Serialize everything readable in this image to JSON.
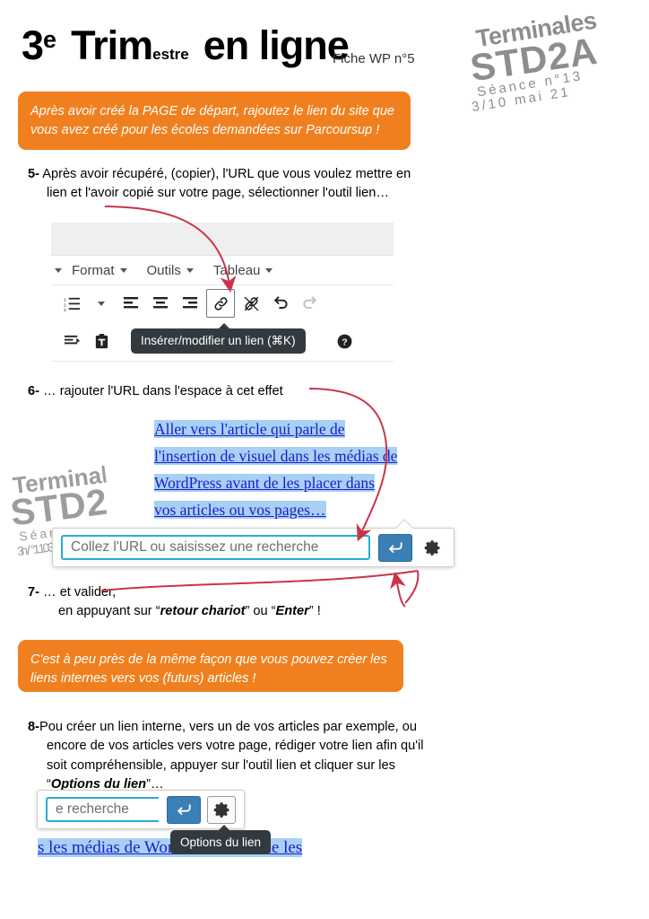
{
  "header": {
    "title_main_1": "3",
    "title_sup": "e",
    "title_main_2": "Trim",
    "title_sub": "estre",
    "title_main_3": "en ligne",
    "sheet_ref": "Fiche WP n°5"
  },
  "logo": {
    "line1": "Terminales",
    "line2": "STD2A",
    "line3": "Séance n°13",
    "line4": "3/10 mai 21"
  },
  "callouts": {
    "first": "Après avoir créé la PAGE de départ, rajoutez le lien du site que vous avez créé pour les écoles demandées sur Parcoursup !",
    "second": "C'est à peu près de la même façon que vous pouvez créer les liens internes vers vos (futurs) articles !"
  },
  "steps": {
    "s5_num": "5-",
    "s5_text": "Après avoir récupéré, (copier), l'URL que vous voulez mettre en lien et l'avoir copié sur votre page, sélectionner l'outil lien…",
    "s6_num": "6-",
    "s6_text": "… rajouter l'URL dans l'espace à cet effet",
    "s7_num": "7-",
    "s7_text": "… et valider,",
    "s7_line2_a": "en appuyant sur “",
    "s7_line2_em1": "retour chariot",
    "s7_line2_b": "” ou “",
    "s7_line2_em2": "Enter",
    "s7_line2_c": "” !",
    "s8_num": "8-",
    "s8_text_a": "Pou créer un lien interne, vers un de vos articles par exemple, ou encore de vos articles vers votre page, rédiger votre lien afin qu'il soit compréhensible, appuyer sur l'outil lien et cliquer sur les “",
    "s8_em": "Options du lien",
    "s8_text_b": "”…"
  },
  "editor": {
    "menus": [
      {
        "label": "Format"
      },
      {
        "label": "Outils"
      },
      {
        "label": "Tableau"
      }
    ],
    "icons_row1": [
      "numbered-list-icon",
      "chevron-down-icon",
      "align-left-icon",
      "align-center-icon",
      "align-right-icon",
      "link-icon",
      "unlink-icon",
      "undo-icon",
      "redo-icon"
    ],
    "icons_row2": [
      "indent-icon",
      "paste-as-text-icon",
      "help-icon"
    ],
    "tooltip_link": "Insérer/modifier un lien (⌘K)",
    "tooltip_options": "Options du lien"
  },
  "link_text": {
    "line1": "Aller vers l'article qui parle de",
    "line2": "l'insertion de visuel dans les médias de",
    "line3": "WordPress avant de les placer dans",
    "line4": "vos articles ou vos pages…",
    "bottom_fragment": "s les médias de WordPress avant de les"
  },
  "url_popup": {
    "placeholder": "Collez l'URL ou saisissez une recherche",
    "value": "",
    "submit_icon": "enter-return-icon",
    "settings_icon": "gear-icon",
    "fragment_text": "e recherche"
  },
  "colors": {
    "orange": "#F0801F",
    "arrow_red": "#C8354B",
    "link_blue": "#1d1dc8",
    "selection_blue": "#a8d0f5",
    "input_border": "#2aa9d6",
    "button_blue": "#3a7fb5",
    "logo_gray": "#8d8d8d"
  }
}
